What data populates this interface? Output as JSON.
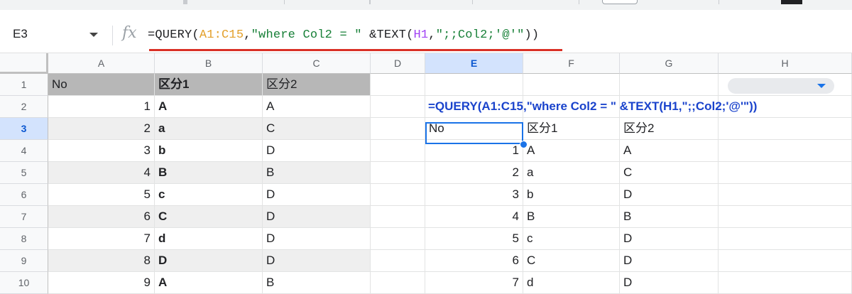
{
  "name_box": "E3",
  "formula": {
    "p1": "=QUERY(",
    "range1": "A1:C15",
    "p2": ",",
    "string1": "\"where Col2 = \"",
    "p3": " &TEXT(",
    "range2": "H1",
    "p4": ",",
    "string2": "\";;Col2;'@'\"",
    "p5": "))"
  },
  "columns": [
    "A",
    "B",
    "C",
    "D",
    "E",
    "F",
    "G",
    "H"
  ],
  "selected_column": "E",
  "rows": [
    "1",
    "2",
    "3",
    "4",
    "5",
    "6",
    "7",
    "8",
    "9",
    "10"
  ],
  "selected_row": "3",
  "table_left": {
    "header": [
      "No",
      "区分1",
      "区分2"
    ],
    "data": [
      [
        "1",
        "A",
        "A"
      ],
      [
        "2",
        "a",
        "C"
      ],
      [
        "3",
        "b",
        "D"
      ],
      [
        "4",
        "B",
        "B"
      ],
      [
        "5",
        "c",
        "D"
      ],
      [
        "6",
        "C",
        "D"
      ],
      [
        "7",
        "d",
        "D"
      ],
      [
        "8",
        "D",
        "D"
      ],
      [
        "9",
        "A",
        "B"
      ]
    ]
  },
  "e2_formula_display": "=QUERY(A1:C15,\"where Col2 = \" &TEXT(H1,\";;Col2;'@'\"))",
  "table_right": {
    "header": [
      "No",
      "区分1",
      "区分2"
    ],
    "data": [
      [
        "1",
        "A",
        "A"
      ],
      [
        "2",
        "a",
        "C"
      ],
      [
        "3",
        "b",
        "D"
      ],
      [
        "4",
        "B",
        "B"
      ],
      [
        "5",
        "c",
        "D"
      ],
      [
        "6",
        "C",
        "D"
      ],
      [
        "7",
        "d",
        "D"
      ]
    ]
  },
  "colors": {
    "accent": "#1a73e8",
    "header_fill": "#b7b7b7",
    "range1": "#e3a02b",
    "string": "#188038",
    "range2": "#a142f4",
    "underline": "#d93025"
  }
}
